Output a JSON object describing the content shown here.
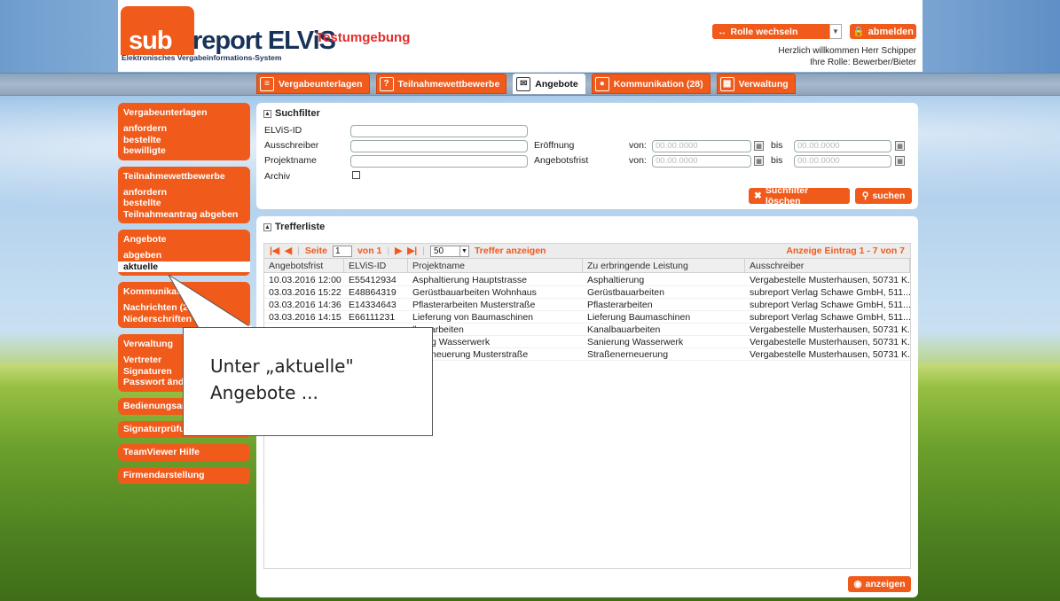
{
  "header": {
    "logo_sub": "sub",
    "logo_report": "report ELViS",
    "logo_tagline": "Elektronisches Vergabeinformations-System",
    "environment": "Testumgebung",
    "role_switch_label": "Rolle wechseln",
    "logout_label": "abmelden",
    "welcome_line1": "Herzlich willkommen Herr Schipper",
    "welcome_line2": "Ihre Rolle: Bewerber/Bieter"
  },
  "tabs": [
    {
      "label": "Vergabeunterlagen",
      "icon": "document-icon"
    },
    {
      "label": "Teilnahmewettbewerbe",
      "icon": "questionnaire-icon"
    },
    {
      "label": "Angebote",
      "icon": "envelope-icon",
      "active": true
    },
    {
      "label": "Kommunikation (28)",
      "icon": "chat-icon"
    },
    {
      "label": "Verwaltung",
      "icon": "calendar-icon"
    }
  ],
  "sidebar": {
    "groups": [
      {
        "title": "Vergabeunterlagen",
        "items": [
          "anfordern",
          "bestellte",
          "bewilligte"
        ]
      },
      {
        "title": "Teilnahmewettbewerbe",
        "items": [
          "anfordern",
          "bestellte",
          "Teilnahmeantrag abgeben"
        ]
      },
      {
        "title": "Angebote",
        "items": [
          "abgeben",
          "aktuelle"
        ]
      },
      {
        "title": "Kommunikation",
        "items": [
          "Nachrichten (28)",
          "Niederschriften"
        ]
      },
      {
        "title": "Verwaltung",
        "items": [
          "Vertreter",
          "Signaturen",
          "Passwort ändern"
        ]
      },
      {
        "title": "Bedienungsanleitung",
        "items": []
      },
      {
        "title": "Signaturprüfung",
        "items": []
      },
      {
        "title": "TeamViewer Hilfe",
        "items": []
      },
      {
        "title": "Firmendarstellung",
        "items": []
      }
    ]
  },
  "filter": {
    "title": "Suchfilter",
    "elvis_id_label": "ELViS-ID",
    "ausschreiber_label": "Ausschreiber",
    "projektname_label": "Projektname",
    "archiv_label": "Archiv",
    "eroeffnung_label": "Eröffnung",
    "angebotsfrist_label": "Angebotsfrist",
    "von_label": "von:",
    "bis_label": "bis",
    "date_placeholder": "00.00.0000",
    "clear_label": "Suchfilter löschen",
    "search_label": "suchen"
  },
  "results": {
    "title": "Trefferliste",
    "pager": {
      "page_label": "Seite",
      "page_value": "1",
      "of_label": "von 1",
      "per_page": "50",
      "per_page_label": "Treffer anzeigen",
      "summary": "Anzeige Eintrag 1 - 7 von 7"
    },
    "columns": [
      "Angebotsfrist",
      "ELViS-ID",
      "Projektname",
      "Zu erbringende Leistung",
      "Ausschreiber"
    ],
    "rows": [
      [
        "10.03.2016 12:00",
        "E55412934",
        "Asphaltierung Hauptstrasse",
        "Asphaltierung",
        "Vergabestelle Musterhausen, 50731 K..."
      ],
      [
        "03.03.2016 15:22",
        "E48864319",
        "Gerüstbauarbeiten Wohnhaus",
        "Gerüstbauarbeiten",
        "subreport Verlag Schawe GmbH, 511..."
      ],
      [
        "03.03.2016 14:36",
        "E14334643",
        "Pflasterarbeiten Musterstraße",
        "Pflasterarbeiten",
        "subreport Verlag Schawe GmbH, 511..."
      ],
      [
        "03.03.2016 14:15",
        "E66111231",
        "Lieferung von Baumaschinen",
        "Lieferung Baumaschinen",
        "subreport Verlag Schawe GmbH, 511..."
      ],
      [
        "",
        "",
        "lbauarbeiten",
        "Kanalbauarbeiten",
        "Vergabestelle Musterhausen, 50731 K..."
      ],
      [
        "",
        "",
        "erung Wasserwerk",
        "Sanierung Wasserwerk",
        "Vergabestelle Musterhausen, 50731 K..."
      ],
      [
        "",
        "",
        "enerneuerung Musterstraße",
        "Straßenerneuerung",
        "Vergabestelle Musterhausen, 50731 K..."
      ]
    ],
    "show_label": "anzeigen"
  },
  "callout": {
    "line1": "Unter „aktuelle\"",
    "line2": "Angebote ..."
  },
  "colors": {
    "accent": "#f05a1a",
    "brand_dark": "#18325a",
    "env_red": "#e52d2d"
  }
}
